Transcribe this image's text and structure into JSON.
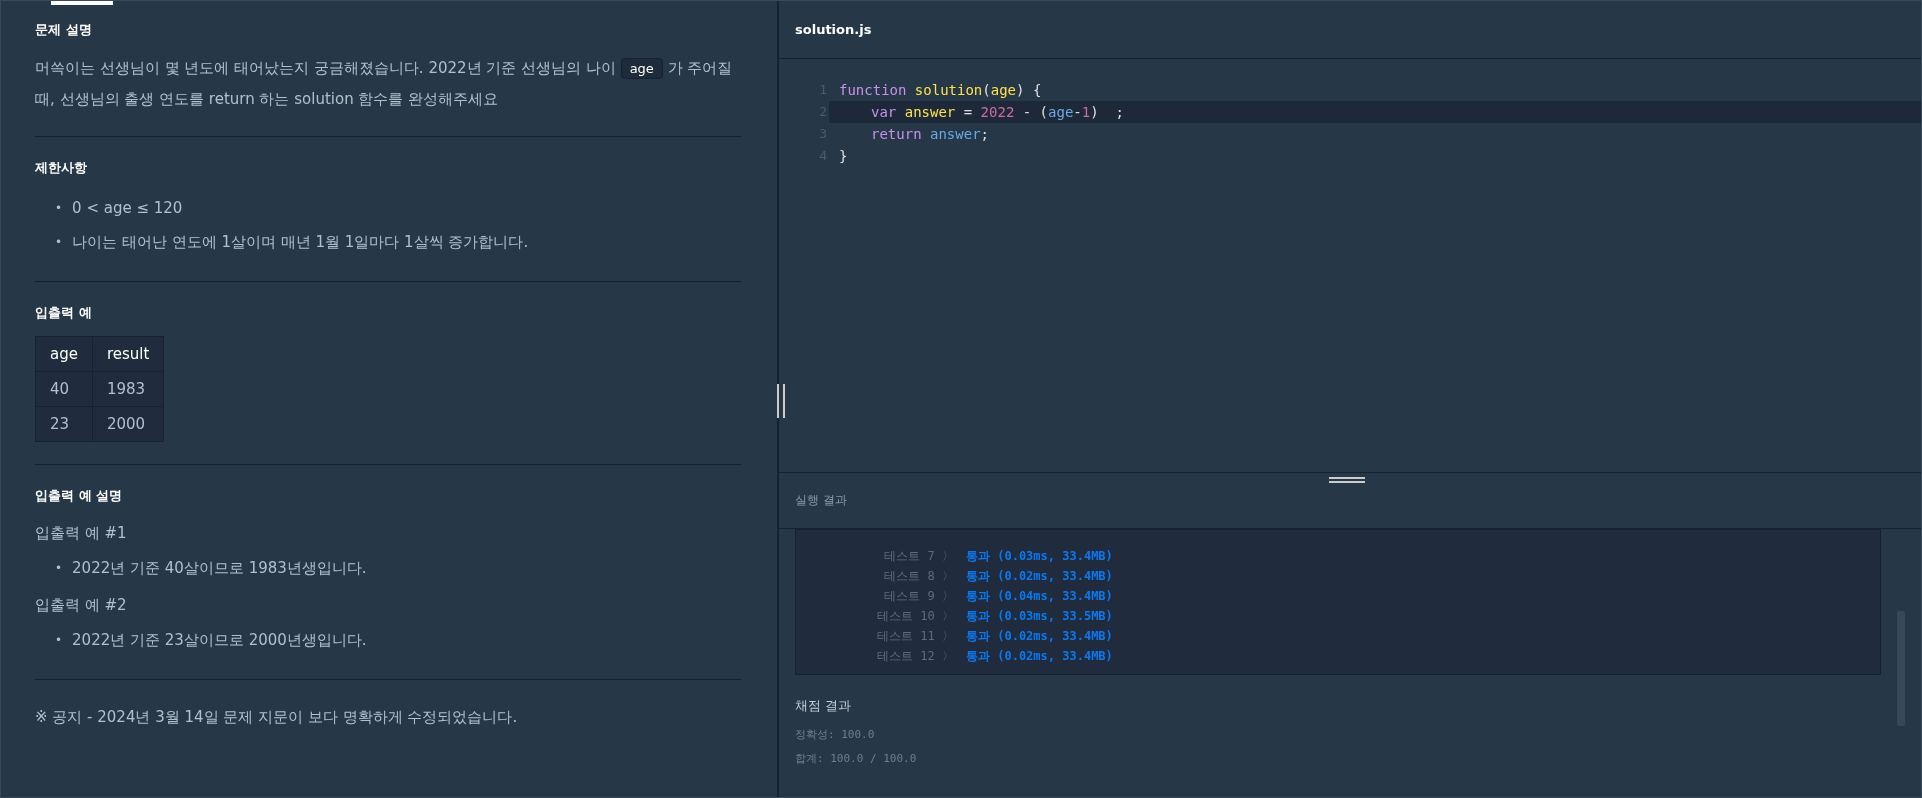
{
  "problem": {
    "sections": [
      {
        "kind": "description",
        "title": "문제 설명",
        "parts": [
          {
            "kind": "text",
            "text": "머쓱이는 선생님이 몇 년도에 태어났는지 궁금해졌습니다. 2022년 기준 선생님의 나이 "
          },
          {
            "kind": "code",
            "text": "age"
          },
          {
            "kind": "text",
            "text": " 가 주어질 때, 선생님의 출생 연도를 return 하는 solution 함수를 완성해주세요"
          }
        ]
      },
      {
        "kind": "bullets",
        "title": "제한사항",
        "items": [
          {
            "bullet": "•",
            "text": "0 < age ≤ 120"
          },
          {
            "bullet": "•",
            "text": "나이는 태어난 연도에 1살이며 매년 1월 1일마다 1살씩 증가합니다."
          }
        ]
      },
      {
        "kind": "table",
        "title": "입출력 예",
        "columns": [
          "age",
          "result"
        ],
        "rows": [
          [
            "40",
            "1983"
          ],
          [
            "23",
            "2000"
          ]
        ]
      },
      {
        "kind": "examples",
        "title": "입출력 예 설명",
        "examples": [
          {
            "label": "입출력 예 #1",
            "items": [
              {
                "bullet": "•",
                "text": "2022년 기준 40살이므로 1983년생입니다."
              }
            ]
          },
          {
            "label": "입출력 예 #2",
            "items": [
              {
                "bullet": "•",
                "text": "2022년 기준 23살이므로 2000년생입니다."
              }
            ]
          }
        ]
      },
      {
        "kind": "notice",
        "text": "※ 공지 - 2024년 3월 14일 문제 지문이 보다 명확하게 수정되었습니다."
      }
    ]
  },
  "editor": {
    "filename": "solution.js",
    "lines": [
      {
        "number": "1",
        "active": false,
        "indented": false,
        "tokens": [
          {
            "kind": "keyword",
            "text": "function "
          },
          {
            "kind": "name",
            "text": "solution"
          },
          {
            "kind": "plain",
            "text": "("
          },
          {
            "kind": "name",
            "text": "age"
          },
          {
            "kind": "plain",
            "text": ") {"
          }
        ]
      },
      {
        "number": "2",
        "active": true,
        "indented": true,
        "tokens": [
          {
            "kind": "keyword",
            "text": "var "
          },
          {
            "kind": "name",
            "text": "answer"
          },
          {
            "kind": "plain",
            "text": " = "
          },
          {
            "kind": "number",
            "text": "2022"
          },
          {
            "kind": "plain",
            "text": " - ("
          },
          {
            "kind": "variable",
            "text": "age"
          },
          {
            "kind": "plain",
            "text": "-"
          },
          {
            "kind": "number",
            "text": "1"
          },
          {
            "kind": "plain",
            "text": ")  ;"
          }
        ]
      },
      {
        "number": "3",
        "active": false,
        "indented": true,
        "tokens": [
          {
            "kind": "keyword",
            "text": "return "
          },
          {
            "kind": "variable",
            "text": "answer"
          },
          {
            "kind": "plain",
            "text": ";"
          }
        ]
      },
      {
        "number": "4",
        "active": false,
        "indented": false,
        "tokens": [
          {
            "kind": "plain",
            "text": "}"
          }
        ]
      }
    ]
  },
  "results": {
    "title": "실행 결과",
    "tests": [
      {
        "label": "테스트 7 〉",
        "result": "통과 (0.03ms, 33.4MB)"
      },
      {
        "label": "테스트 8 〉",
        "result": "통과 (0.02ms, 33.4MB)"
      },
      {
        "label": "테스트 9 〉",
        "result": "통과 (0.04ms, 33.4MB)"
      },
      {
        "label": "테스트 10 〉",
        "result": "통과 (0.03ms, 33.5MB)"
      },
      {
        "label": "테스트 11 〉",
        "result": "통과 (0.02ms, 33.4MB)"
      },
      {
        "label": "테스트 12 〉",
        "result": "통과 (0.02ms, 33.4MB)"
      }
    ],
    "score_title": "채점 결과",
    "score_lines": [
      "정확성: 100.0",
      "합계: 100.0 / 100.0"
    ]
  }
}
